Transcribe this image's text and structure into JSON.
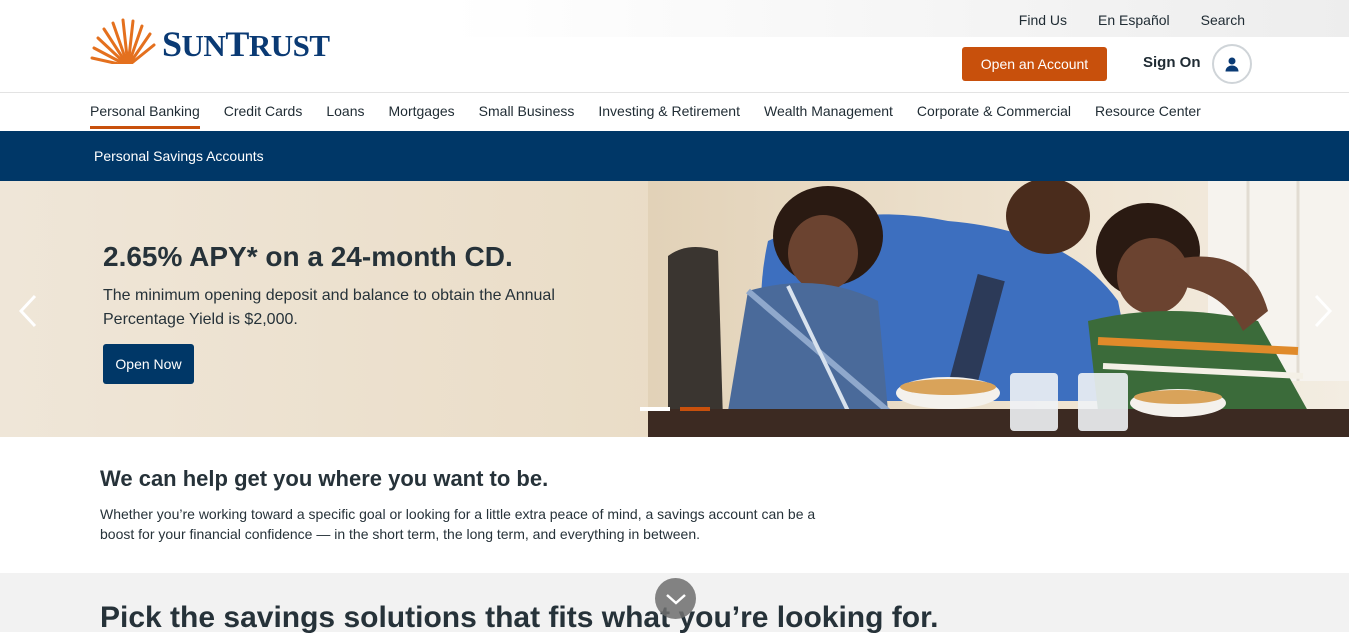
{
  "utility": {
    "find_us": "Find Us",
    "espanol": "En Español",
    "search": "Search"
  },
  "brand": {
    "name": "SunTrust",
    "accent": "#c8500c",
    "navy": "#003767"
  },
  "header": {
    "open_account": "Open an Account",
    "sign_on": "Sign On"
  },
  "nav": {
    "items": [
      "Personal Banking",
      "Credit Cards",
      "Loans",
      "Mortgages",
      "Small Business",
      "Investing & Retirement",
      "Wealth Management",
      "Corporate & Commercial",
      "Resource Center"
    ],
    "active": "Personal Banking"
  },
  "subnav": {
    "label": "Personal Savings Accounts"
  },
  "hero": {
    "title": "2.65% APY* on a 24-month CD.",
    "description": "The minimum opening deposit and balance to obtain the Annual Percentage Yield is $2,000.",
    "button": "Open Now",
    "slide_count": 2,
    "active_slide": 2
  },
  "intro": {
    "title": "We can help get you where you want to be.",
    "text": "Whether you’re working toward a specific goal or looking for a little extra peace of mind, a savings account can be a boost for your financial confidence — in the short term, the long term, and everything in between."
  },
  "pick": {
    "title": "Pick the savings solutions that fits what you’re looking for."
  },
  "icons": {
    "user": "user-icon",
    "prev": "chevron-left-icon",
    "next": "chevron-right-icon",
    "down": "chevron-down-icon",
    "logo": "sun-burst-icon"
  }
}
